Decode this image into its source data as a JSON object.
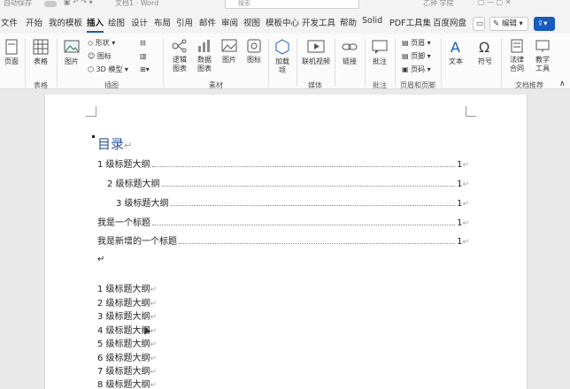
{
  "titlebar": {
    "autosave_label": "自动保存",
    "doc_title": "文档1 · Word",
    "search_placeholder": "搜索",
    "user_name": "乙钟 学院"
  },
  "menu": {
    "tabs": [
      "文件",
      "开始",
      "我的模板",
      "插入",
      "绘图",
      "设计",
      "布局",
      "引用",
      "邮件",
      "审阅",
      "视图",
      "模板中心",
      "开发工具",
      "帮助",
      "Solid",
      "PDF工具集",
      "百度网盘"
    ],
    "active_tab": "插入",
    "edit_button": "编辑",
    "comment_icon": "comment-icon",
    "share_icon": "share-icon"
  },
  "ribbon": {
    "pages": "页面",
    "table": "表格",
    "picture": "图片",
    "shapes": "形状",
    "icons": "图标",
    "model3d": "3D 模型",
    "logic_chart": "逻辑图表",
    "data_chart": "数据图表",
    "material_pic": "图片",
    "material_icon": "图标",
    "addins": "加载项",
    "online_video": "联机视频",
    "link": "链接",
    "comment": "批注",
    "header": "页眉",
    "footer": "页脚",
    "page_number": "页码",
    "textbox": "文本",
    "symbol": "符号",
    "legal_contract": "法律合同",
    "teaching_tool": "教学工具",
    "groups": {
      "table": "表格",
      "illustrations": "插图",
      "material": "素材",
      "media": "媒体",
      "comments": "批注",
      "header_footer": "页眉和页脚",
      "doc_recommend": "文档推荐"
    }
  },
  "document": {
    "toc_title": "目录",
    "return_mark": "↵",
    "toc_entries": [
      {
        "text": "1 级标题大纲",
        "page": "1",
        "indent": 0
      },
      {
        "text": "2 级标题大纲",
        "page": "1",
        "indent": 1
      },
      {
        "text": "3 级标题大纲",
        "page": "1",
        "indent": 2
      },
      {
        "text": "我是一个标题",
        "page": "1",
        "indent": 0
      },
      {
        "text": "我是新增的一个标题",
        "page": "1",
        "indent": 0
      }
    ],
    "body_lines": [
      "1 级标题大纲",
      "2 级标题大纲",
      "3 级标题大纲",
      "4 级标题大纲",
      "5 级标题大纲",
      "6 级标题大纲",
      "7 级标题大纲",
      "8 级标题大纲"
    ]
  }
}
